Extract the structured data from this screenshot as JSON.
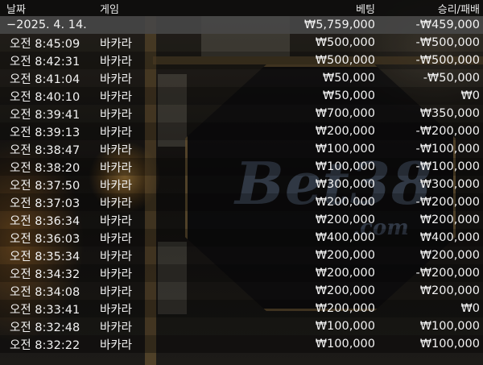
{
  "headers": {
    "date": "날짜",
    "game": "게임",
    "bet": "베팅",
    "result": "승리/패배"
  },
  "group": {
    "date": "−2025. 4. 14.",
    "bet": "₩5,759,000",
    "result": "-₩459,000"
  },
  "rows": [
    {
      "time": "오전 8:45:09",
      "game": "바카라",
      "bet": "₩500,000",
      "result": "-₩500,000"
    },
    {
      "time": "오전 8:42:31",
      "game": "바카라",
      "bet": "₩500,000",
      "result": "-₩500,000"
    },
    {
      "time": "오전 8:41:04",
      "game": "바카라",
      "bet": "₩50,000",
      "result": "-₩50,000"
    },
    {
      "time": "오전 8:40:10",
      "game": "바카라",
      "bet": "₩50,000",
      "result": "₩0"
    },
    {
      "time": "오전 8:39:41",
      "game": "바카라",
      "bet": "₩700,000",
      "result": "₩350,000"
    },
    {
      "time": "오전 8:39:13",
      "game": "바카라",
      "bet": "₩200,000",
      "result": "-₩200,000"
    },
    {
      "time": "오전 8:38:47",
      "game": "바카라",
      "bet": "₩100,000",
      "result": "-₩100,000"
    },
    {
      "time": "오전 8:38:20",
      "game": "바카라",
      "bet": "₩100,000",
      "result": "-₩100,000"
    },
    {
      "time": "오전 8:37:50",
      "game": "바카라",
      "bet": "₩300,000",
      "result": "₩300,000"
    },
    {
      "time": "오전 8:37:03",
      "game": "바카라",
      "bet": "₩200,000",
      "result": "-₩200,000"
    },
    {
      "time": "오전 8:36:34",
      "game": "바카라",
      "bet": "₩200,000",
      "result": "₩200,000"
    },
    {
      "time": "오전 8:36:03",
      "game": "바카라",
      "bet": "₩400,000",
      "result": "₩400,000"
    },
    {
      "time": "오전 8:35:34",
      "game": "바카라",
      "bet": "₩200,000",
      "result": "₩200,000"
    },
    {
      "time": "오전 8:34:32",
      "game": "바카라",
      "bet": "₩200,000",
      "result": "-₩200,000"
    },
    {
      "time": "오전 8:34:08",
      "game": "바카라",
      "bet": "₩200,000",
      "result": "₩200,000"
    },
    {
      "time": "오전 8:33:41",
      "game": "바카라",
      "bet": "₩200,000",
      "result": "₩0"
    },
    {
      "time": "오전 8:32:48",
      "game": "바카라",
      "bet": "₩100,000",
      "result": "₩100,000"
    },
    {
      "time": "오전 8:32:22",
      "game": "바카라",
      "bet": "₩100,000",
      "result": "₩100,000"
    }
  ],
  "watermark": {
    "main": "Bet38",
    "sub": ".com"
  }
}
